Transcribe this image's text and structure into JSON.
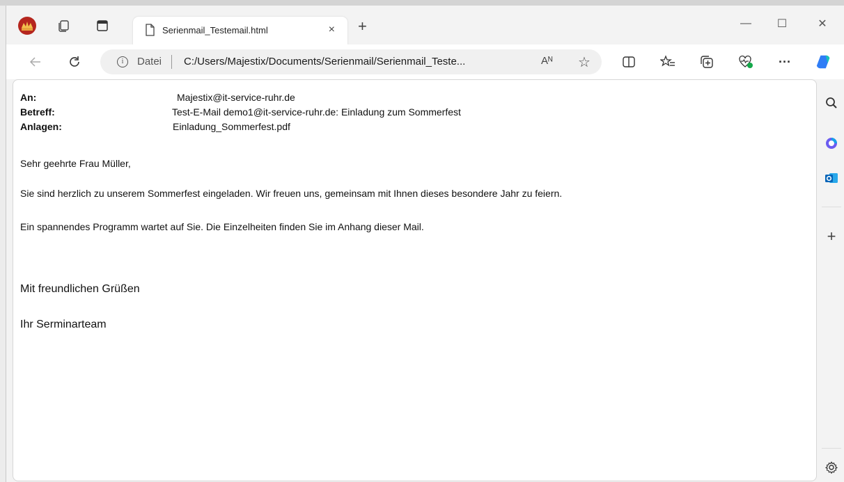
{
  "tab": {
    "title": "Serienmail_Testemail.html",
    "close": "×",
    "new_tab": "+"
  },
  "address": {
    "info": "i",
    "scheme_label": "Datei",
    "url": "C:/Users/Majestix/Documents/Serienmail/Serienmail_Teste...",
    "read_aloud": "Aᴺ"
  },
  "window": {
    "minimize": "—",
    "maximize": "☐",
    "close": "✕"
  },
  "toolbar": {
    "more": "···"
  },
  "email": {
    "to_label": "An:",
    "to_value": "Majestix@it-service-ruhr.de",
    "subject_label": "Betreff:",
    "subject_value": "Test-E-Mail demo1@it-service-ruhr.de: Einladung zum Sommerfest",
    "attachments_label": "Anlagen:",
    "attachments_value": "Einladung_Sommerfest.pdf",
    "salutation": "Sehr geehrte Frau Müller,",
    "paragraph1": "Sie sind herzlich zu unserem Sommerfest eingeladen. Wir freuen uns, gemeinsam mit Ihnen dieses besondere Jahr zu feiern.",
    "paragraph2": "Ein spannendes Programm wartet auf Sie. Die Einzelheiten finden Sie im Anhang dieser Mail.",
    "closing": "Mit freundlichen Grüßen",
    "signature": "Ihr Serminarteam"
  },
  "sidebar": {
    "add": "+"
  },
  "colors": {
    "accent": "#0f6cbd",
    "outlook": "#0364b8",
    "copilot": "#2f7df6"
  }
}
